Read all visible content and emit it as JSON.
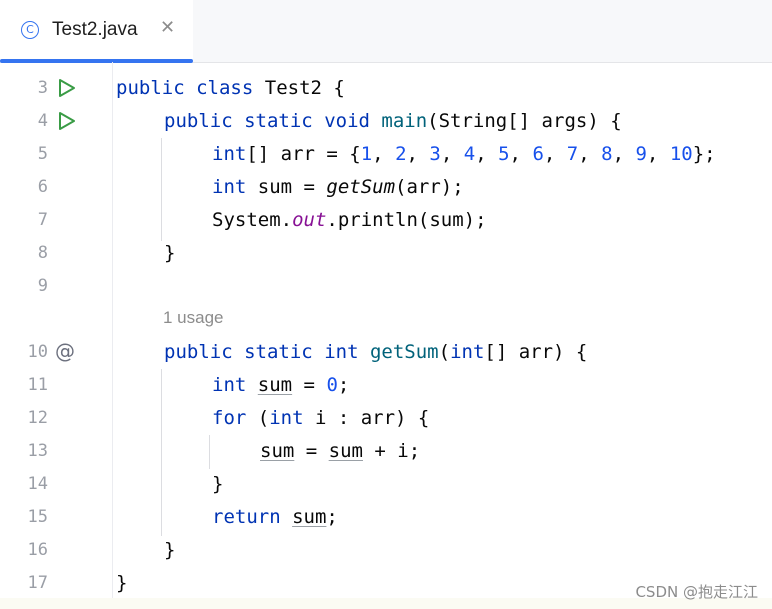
{
  "tab": {
    "title": "Test2.java",
    "icon": "class-icon",
    "close_glyph": "✕",
    "class_glyph": "C"
  },
  "usage_hint": "1 usage",
  "watermark": "CSDN @抱走江江",
  "lines": [
    {
      "num": "3",
      "gutter_icon": "run-icon"
    },
    {
      "num": "4",
      "gutter_icon": "run-icon"
    },
    {
      "num": "5"
    },
    {
      "num": "6"
    },
    {
      "num": "7"
    },
    {
      "num": "8"
    },
    {
      "num": "9"
    },
    {
      "num": "10",
      "gutter_icon": "at-icon"
    },
    {
      "num": "11"
    },
    {
      "num": "12"
    },
    {
      "num": "13"
    },
    {
      "num": "14"
    },
    {
      "num": "15"
    },
    {
      "num": "16"
    },
    {
      "num": "17"
    }
  ],
  "code": {
    "l3": {
      "kw1": "public",
      "kw2": "class",
      "name": "Test2",
      "rest": " {"
    },
    "l4": {
      "kw1": "public",
      "kw2": "static",
      "kw3": "void",
      "fn": "main",
      "rest": "(String[] args) {"
    },
    "l5": {
      "kw1": "int",
      "a": "[] arr = {",
      "n1": "1",
      "n2": "2",
      "n3": "3",
      "n4": "4",
      "n5": "5",
      "n6": "6",
      "n7": "7",
      "n8": "8",
      "n9": "9",
      "n10": "10",
      "end": "};"
    },
    "l6": {
      "kw1": "int",
      "a": " sum = ",
      "call": "getSum",
      "rest": "(arr);"
    },
    "l7": {
      "a": "System.",
      "field": "out",
      "rest": ".println(sum);"
    },
    "l8": {
      "a": "}"
    },
    "l10": {
      "kw1": "public",
      "kw2": "static",
      "kw3": "int",
      "fn": "getSum",
      "p1": "(",
      "kw4": "int",
      "rest": "[] arr) {"
    },
    "l11": {
      "kw1": "int",
      "var": "sum",
      "a": " = ",
      "num": "0",
      "end": ";"
    },
    "l12": {
      "kw1": "for",
      "a": " (",
      "kw2": "int",
      "rest": " i : arr) {"
    },
    "l13": {
      "var1": "sum",
      "a": " = ",
      "var2": "sum",
      "rest": " + i;"
    },
    "l14": {
      "a": "}"
    },
    "l15": {
      "kw1": "return",
      "var": "sum",
      "end": ";"
    },
    "l16": {
      "a": "}"
    },
    "l17": {
      "a": "}"
    }
  },
  "colors": {
    "keyword": "#0033b3",
    "function": "#00627a",
    "number": "#1750eb",
    "static_field": "#871094",
    "accent": "#3574f0",
    "run": "#3a9c46"
  }
}
